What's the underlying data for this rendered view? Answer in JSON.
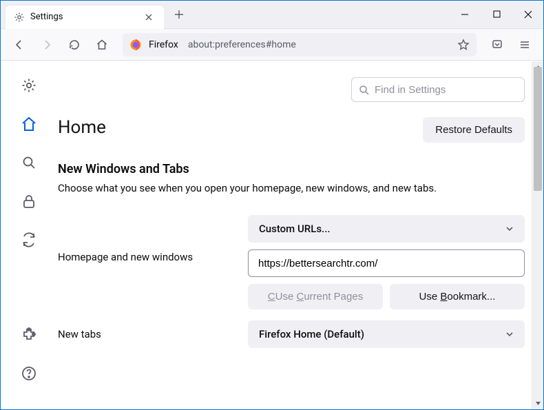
{
  "tab": {
    "title": "Settings"
  },
  "url": {
    "label": "Firefox",
    "path": "about:preferences#home"
  },
  "search": {
    "placeholder": "Find in Settings"
  },
  "page": {
    "title": "Home",
    "restore_label": "Restore Defaults"
  },
  "section": {
    "title": "New Windows and Tabs",
    "desc": "Choose what you see when you open your homepage, new windows, and new tabs."
  },
  "rows": {
    "homepage_label": "Homepage and new windows",
    "homepage_select": "Custom URLs...",
    "homepage_url": "https://bettersearchtr.com/",
    "use_current": "Use Current Pages",
    "use_bookmark": "Use Bookmark...",
    "newtabs_label": "New tabs",
    "newtabs_select": "Firefox Home (Default)"
  },
  "icons": {
    "gear": "gear-icon",
    "home": "home-icon",
    "search": "search-icon",
    "lock": "lock-icon",
    "sync": "sync-icon",
    "ext": "extensions-icon",
    "help": "help-icon"
  }
}
